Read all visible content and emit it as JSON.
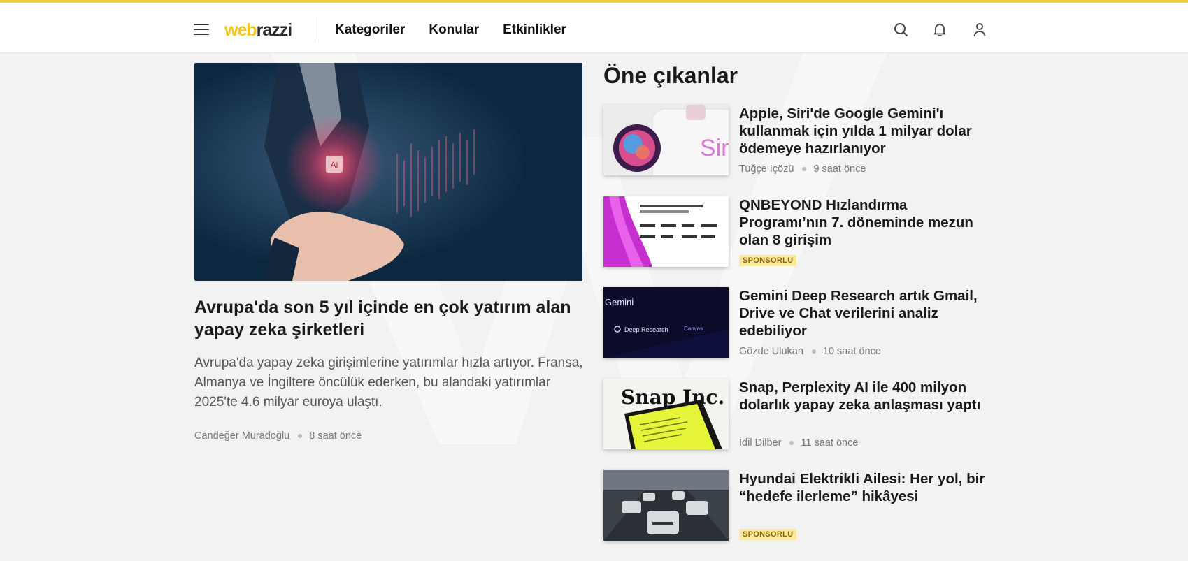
{
  "colors": {
    "accent": "#f5d042",
    "badge_bg": "#fbe9a0",
    "badge_text": "#8a6a00"
  },
  "header": {
    "menu_icon": "hamburger-menu-icon",
    "logo": {
      "part1": "web",
      "part2": "razzi"
    },
    "nav": [
      "Kategoriler",
      "Konular",
      "Etkinlikler"
    ],
    "icons": [
      "search-icon",
      "bell-icon",
      "user-icon"
    ]
  },
  "hero": {
    "image": "ai-hand-illustration",
    "title": "Avrupa'da son 5 yıl içinde en çok yatırım alan yapay zeka şirketleri",
    "summary": "Avrupa'da yapay zeka girişimlerine yatırımlar hızla artıyor. Fransa, Almanya ve İngiltere öncülük ederken, bu alandaki yatırımlar 2025'te 4.6 milyar euroya ulaştı.",
    "author": "Candeğer Muradoğlu",
    "time": "8 saat önce"
  },
  "featured": {
    "title": "Öne çıkanlar",
    "items": [
      {
        "title": "Apple, Siri'de Google Gemini'ı kullanmak için yılda 1 milyar dolar ödemeye hazırlanıyor",
        "author": "Tuğçe İçözü",
        "time": "9 saat önce",
        "thumb_text": "Siri"
      },
      {
        "title": "QNBEYOND Hızlandırma Programı’nın 7. döneminde mezun olan 8 girişim",
        "badge": "SPONSORLU"
      },
      {
        "title": "Gemini Deep Research artık Gmail, Drive ve Chat verilerini analiz edebiliyor",
        "author": "Gözde Ulukan",
        "time": "10 saat önce",
        "thumb_text": "Gemini",
        "thumb_sub1": "Deep Research",
        "thumb_sub2": "Canvas"
      },
      {
        "title": "Snap, Perplexity AI ile 400 milyon dolarlık yapay zeka anlaşması yaptı",
        "author": "İdil Dilber",
        "time": "11 saat önce",
        "thumb_text": "Snap Inc."
      },
      {
        "title": "Hyundai Elektrikli Ailesi: Her yol, bir “hedefe ilerleme” hikâyesi",
        "badge": "SPONSORLU"
      }
    ]
  }
}
